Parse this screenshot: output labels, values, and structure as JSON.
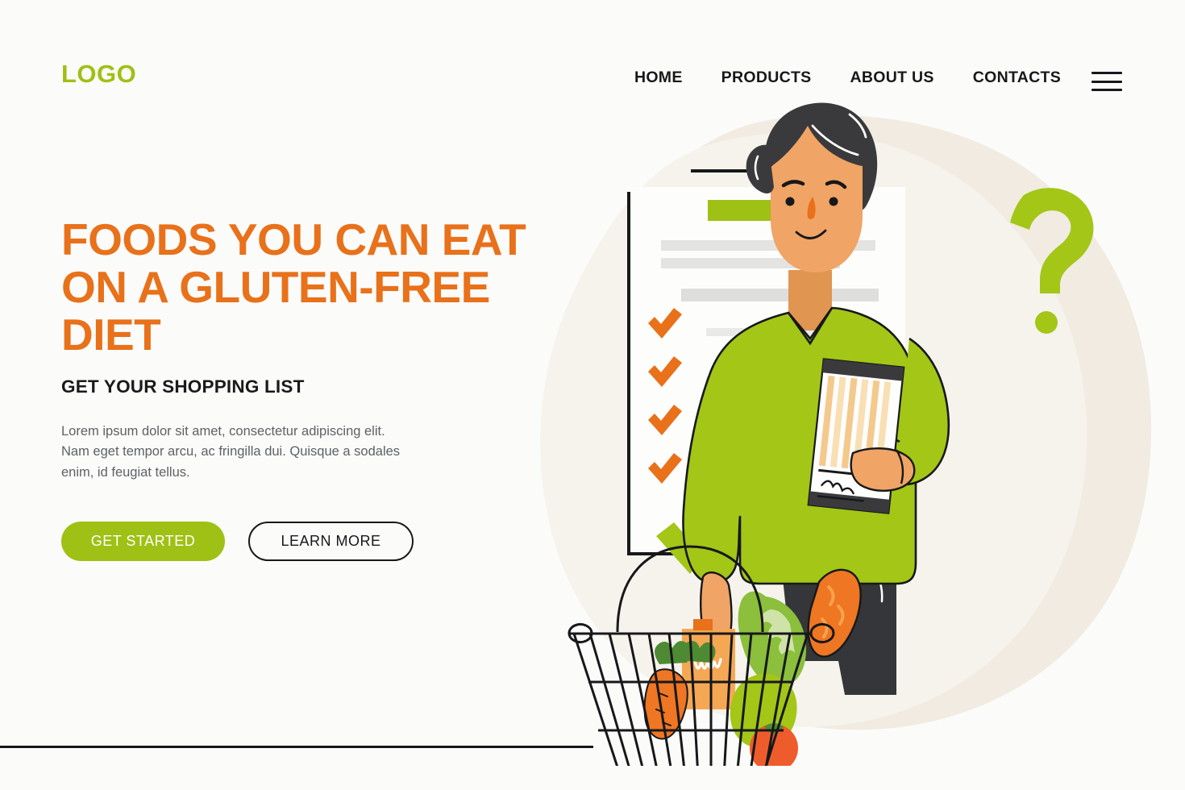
{
  "header": {
    "logo": "LOGO",
    "nav": [
      {
        "label": "HOME",
        "name": "nav-home"
      },
      {
        "label": "PRODUCTS",
        "name": "nav-products"
      },
      {
        "label": "ABOUT US",
        "name": "nav-about-us"
      },
      {
        "label": "CONTACTS",
        "name": "nav-contacts"
      }
    ],
    "menu_icon": "hamburger-menu-icon"
  },
  "hero": {
    "title": "FOODS YOU CAN EAT ON A GLUTEN-FREE DIET",
    "subtitle": "GET YOUR SHOPPING LIST",
    "paragraph": "Lorem ipsum dolor sit amet, consectetur adipiscing elit. Nam eget tempor arcu, ac fringilla dui. Quisque a sodales enim, id feugiat tellus.",
    "primary_button": "GET STARTED",
    "secondary_button": "LEARN MORE"
  },
  "illustration": {
    "description": "Man holding a pasta package and a shopping basket with vegetables in front of a checklist document",
    "checklist": {
      "header_bar": "green-title-bar",
      "text_lines": 3,
      "checked_items": 4,
      "check_icon": "orange-checkmark-icon"
    },
    "question_mark": "?",
    "approval_check": "green-checkmark-icon",
    "basket_items": [
      "carrot",
      "lettuce",
      "baguette",
      "tomato",
      "juice-carton",
      "greens"
    ],
    "held_item": "spaghetti-pasta-package"
  },
  "colors": {
    "accent_orange": "#E8711A",
    "accent_green": "#9FC015",
    "illustration_green": "#A3C617",
    "skin": "#F0A465",
    "hair": "#3A3A3C",
    "pants": "#353639",
    "blob_light": "#F6F3ED",
    "blob_dark": "#F1EBE1",
    "page_background": "#FBFBFA",
    "text_dark": "#17181A",
    "text_muted": "#5E6165"
  }
}
